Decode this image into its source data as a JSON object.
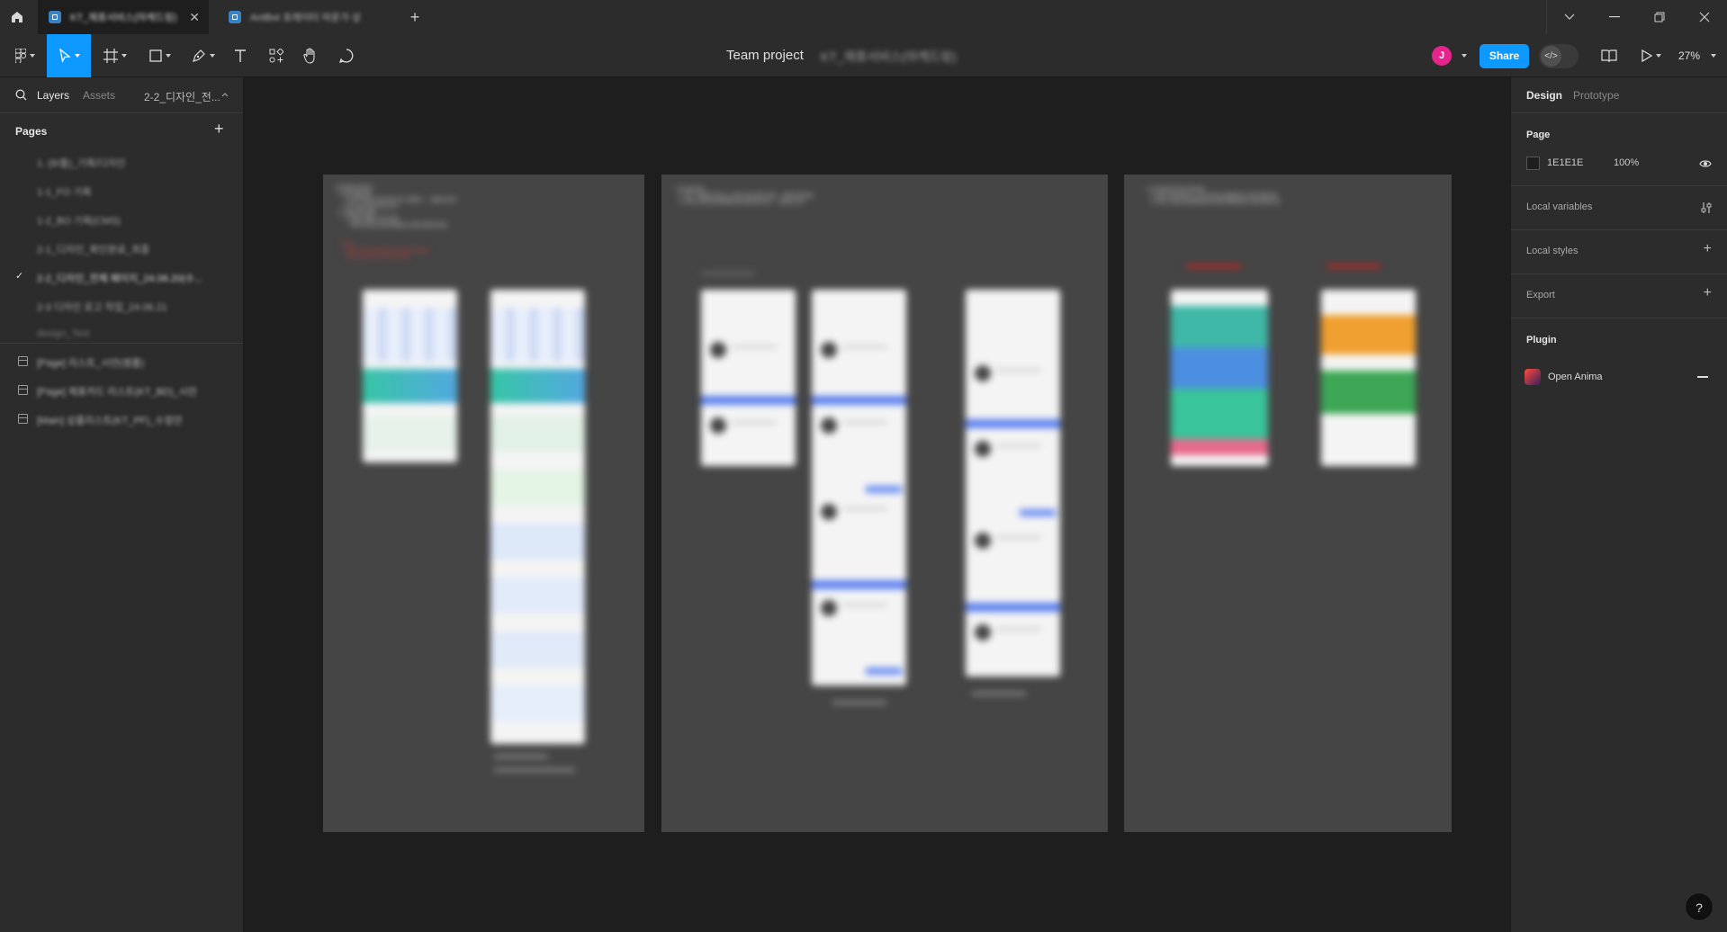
{
  "tabs": [
    {
      "title": "KT_제휴서비스(마케드링)",
      "active": true
    },
    {
      "title": "AntBot 포레이터 마운가 상",
      "active": false
    }
  ],
  "toolbar": {
    "team_label": "Team project",
    "file_name": "KT_제휴서비스(마케드링)",
    "avatar_initial": "J",
    "share_label": "Share",
    "zoom": "27%"
  },
  "left_panel": {
    "tabs": {
      "layers": "Layers",
      "assets": "Assets"
    },
    "current_page": "2-2_디자인_전...",
    "pages_heading": "Pages",
    "pages": [
      {
        "label": "1. (8/출)_기획/디자인",
        "checked": false
      },
      {
        "label": "1-1_FO 기획",
        "checked": false
      },
      {
        "label": "1-2_BO 기획(CMS)",
        "checked": false
      },
      {
        "label": "2-1_디자인_확인완료_최종",
        "checked": false
      },
      {
        "label": "2-2_디자인_전체 페이지_24.06.20(수...",
        "checked": true
      },
      {
        "label": "2-3 디자인 로고 작업_24.06.21",
        "checked": false
      },
      {
        "label": "design_Test",
        "checked": false
      }
    ],
    "layers": [
      {
        "label": "[Page] 리스트_시안(썸플)"
      },
      {
        "label": "[Page] 제휴카드 리스트(KT_BD)_시안"
      },
      {
        "label": "[Main] 상품리스트(KT_PF)_수정안"
      }
    ]
  },
  "canvas": {
    "boards": [
      {
        "notes": [
          {
            "text": "• 수정사항_24.06.07",
            "red": false
          },
          {
            "text": "    a. 상단 퍼블 영역",
            "red": false
          },
          {
            "text": "        1. 상단 타이틀 아이콘 영역 수정 : 제휴카드 → 제휴카드/포크",
            "red": false
          },
          {
            "text": "        2. KT Only 전용 (기타) 수정",
            "red": false
          },
          {
            "text": "    b. 이벤트 배너 영역",
            "red": false
          },
          {
            "text": "        1. 이벤트 전체보기 위치 조정",
            "red": false
          },
          {
            "text": "           - 이미지 하단 및 광고군처럼 좀 더 함께 조합하여 배치",
            "red": false
          },
          {
            "text": "    * 주석시",
            "red": true
          },
          {
            "text": "       - 이미지 사이즈 및 사용자 조사 전후 비교 필요",
            "red": true
          },
          {
            "text": "       - 기존 리스트 라운드 처리 여부 확인",
            "red": true
          }
        ]
      },
      {
        "notes": [
          {
            "text": "• 시안 검토 필요",
            "red": false
          },
          {
            "text": "    a. 기존 - 5/30(목) 수정_v1.1 버전 기반 디자인 진행 → 사업부 검토 필요",
            "red": false
          },
          {
            "text": "    b. 서비스 네이밍 변경 확정에 따라 변경 반영 가능 → 개발 1일 소요",
            "red": false
          }
        ]
      },
      {
        "notes": [
          {
            "text": "• 시안 '레이아웃' 위주 검토 필요",
            "red": false
          },
          {
            "text": "    a. 운영사 작업 페이지 도 리스트 배너 및 방향 배너 이미지 변경 작업",
            "red": false
          },
          {
            "text": "    b. 서비스 네이밍 변경 확정에 따라 생활 적용할 예상 디자인 변경 가능",
            "red": false
          }
        ]
      }
    ]
  },
  "right_panel": {
    "tabs": {
      "design": "Design",
      "prototype": "Prototype"
    },
    "page_heading": "Page",
    "page_color": "1E1E1E",
    "page_opacity": "100%",
    "sections": [
      "Local variables",
      "Local styles",
      "Export"
    ],
    "plugin_heading": "Plugin",
    "plugin_name": "Open Anima"
  },
  "help_label": "?",
  "colors": {
    "accent": "#0d99ff",
    "avatar": "#e6258c",
    "canvas_bg": "#1E1E1E",
    "board_bg": "#454545",
    "panel_bg": "#2c2c2c"
  },
  "icons": [
    "home-icon",
    "figma-file-icon",
    "close-icon",
    "plus-icon",
    "chevron-down-icon",
    "minimize-icon",
    "restore-icon",
    "close-window-icon",
    "figma-menu-icon",
    "move-tool-icon",
    "frame-tool-icon",
    "rectangle-tool-icon",
    "pen-tool-icon",
    "text-tool-icon",
    "components-icon",
    "hand-tool-icon",
    "comment-icon",
    "dev-mode-icon",
    "library-icon",
    "play-icon",
    "search-icon",
    "checkmark-icon",
    "frame-layer-icon",
    "eye-icon",
    "variables-icon",
    "minus-icon",
    "help-icon"
  ]
}
